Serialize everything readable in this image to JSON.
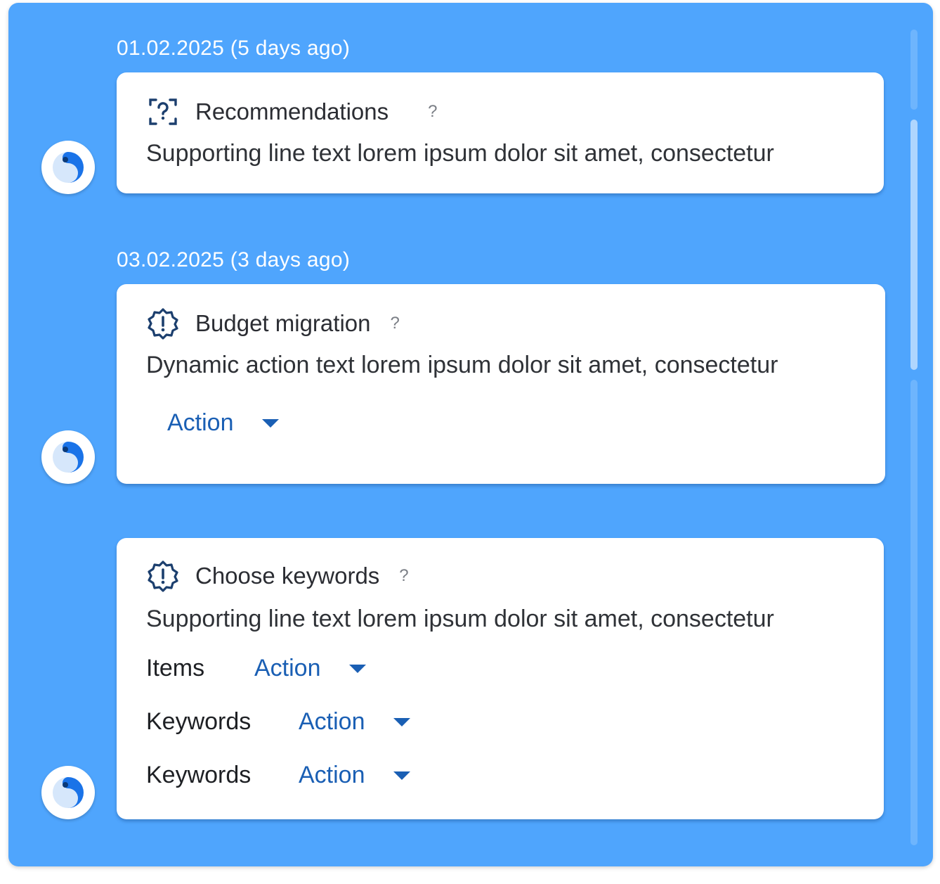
{
  "timeline": [
    {
      "date": "01.02.2025 (5 days ago)",
      "icon": "unknown-document-icon",
      "title": "Recommendations",
      "help": "?",
      "text": "Supporting line text lorem ipsum dolor sit amet, consectetur"
    },
    {
      "date": "03.02.2025 (3 days ago)",
      "icon": "alert-badge-icon",
      "title": "Budget migration",
      "help": "?",
      "text": "Dynamic action text lorem ipsum dolor sit amet, consectetur",
      "action": "Action"
    },
    {
      "icon": "alert-badge-icon",
      "title": "Choose keywords",
      "help": "?",
      "text": "Supporting line text lorem ipsum dolor sit amet, consectetur",
      "rows": [
        {
          "label": "Items",
          "action": "Action"
        },
        {
          "label": "Keywords",
          "action": "Action"
        },
        {
          "label": "Keywords",
          "action": "Action"
        }
      ]
    }
  ],
  "colors": {
    "background": "#4fa5fd",
    "link": "#1a5fb4",
    "icon": "#1c3f6e",
    "avatar_accent": "#1a73e8"
  }
}
